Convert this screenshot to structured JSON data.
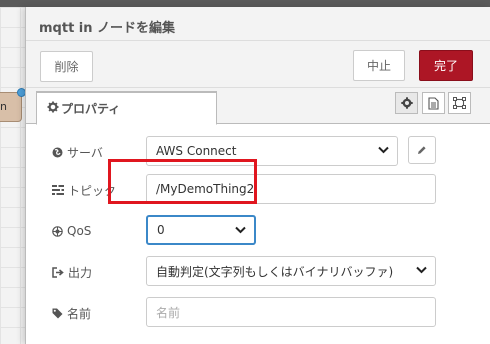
{
  "background": {
    "node_label": "n",
    "colors": {
      "node": "#d8bfa8",
      "port": "#4ea1dc"
    }
  },
  "tray": {
    "title": "mqtt in ノードを編集",
    "buttons": {
      "delete": "削除",
      "cancel": "中止",
      "done": "完了"
    },
    "tabs": [
      {
        "label": "プロパティ",
        "icon": "gear-icon"
      }
    ],
    "icon_tabs": [
      "settings-icon",
      "description-icon",
      "appearance-icon"
    ]
  },
  "form": {
    "server": {
      "label": "サーバ",
      "icon": "globe-icon",
      "value": "AWS Connect"
    },
    "topic": {
      "label": "トピック",
      "icon": "tasks-icon",
      "value": "/MyDemoThing2"
    },
    "qos": {
      "label": "QoS",
      "icon": "empire-icon",
      "value": "0"
    },
    "output": {
      "label": "出力",
      "icon": "sign-out-icon",
      "value": "自動判定(文字列もしくはバイナリバッファ)"
    },
    "name": {
      "label": "名前",
      "icon": "tag-icon",
      "value": "",
      "placeholder": "名前"
    }
  },
  "colors": {
    "accent": "#ad1625",
    "highlight_box": "#e0161f",
    "focus": "#3b88c8"
  }
}
